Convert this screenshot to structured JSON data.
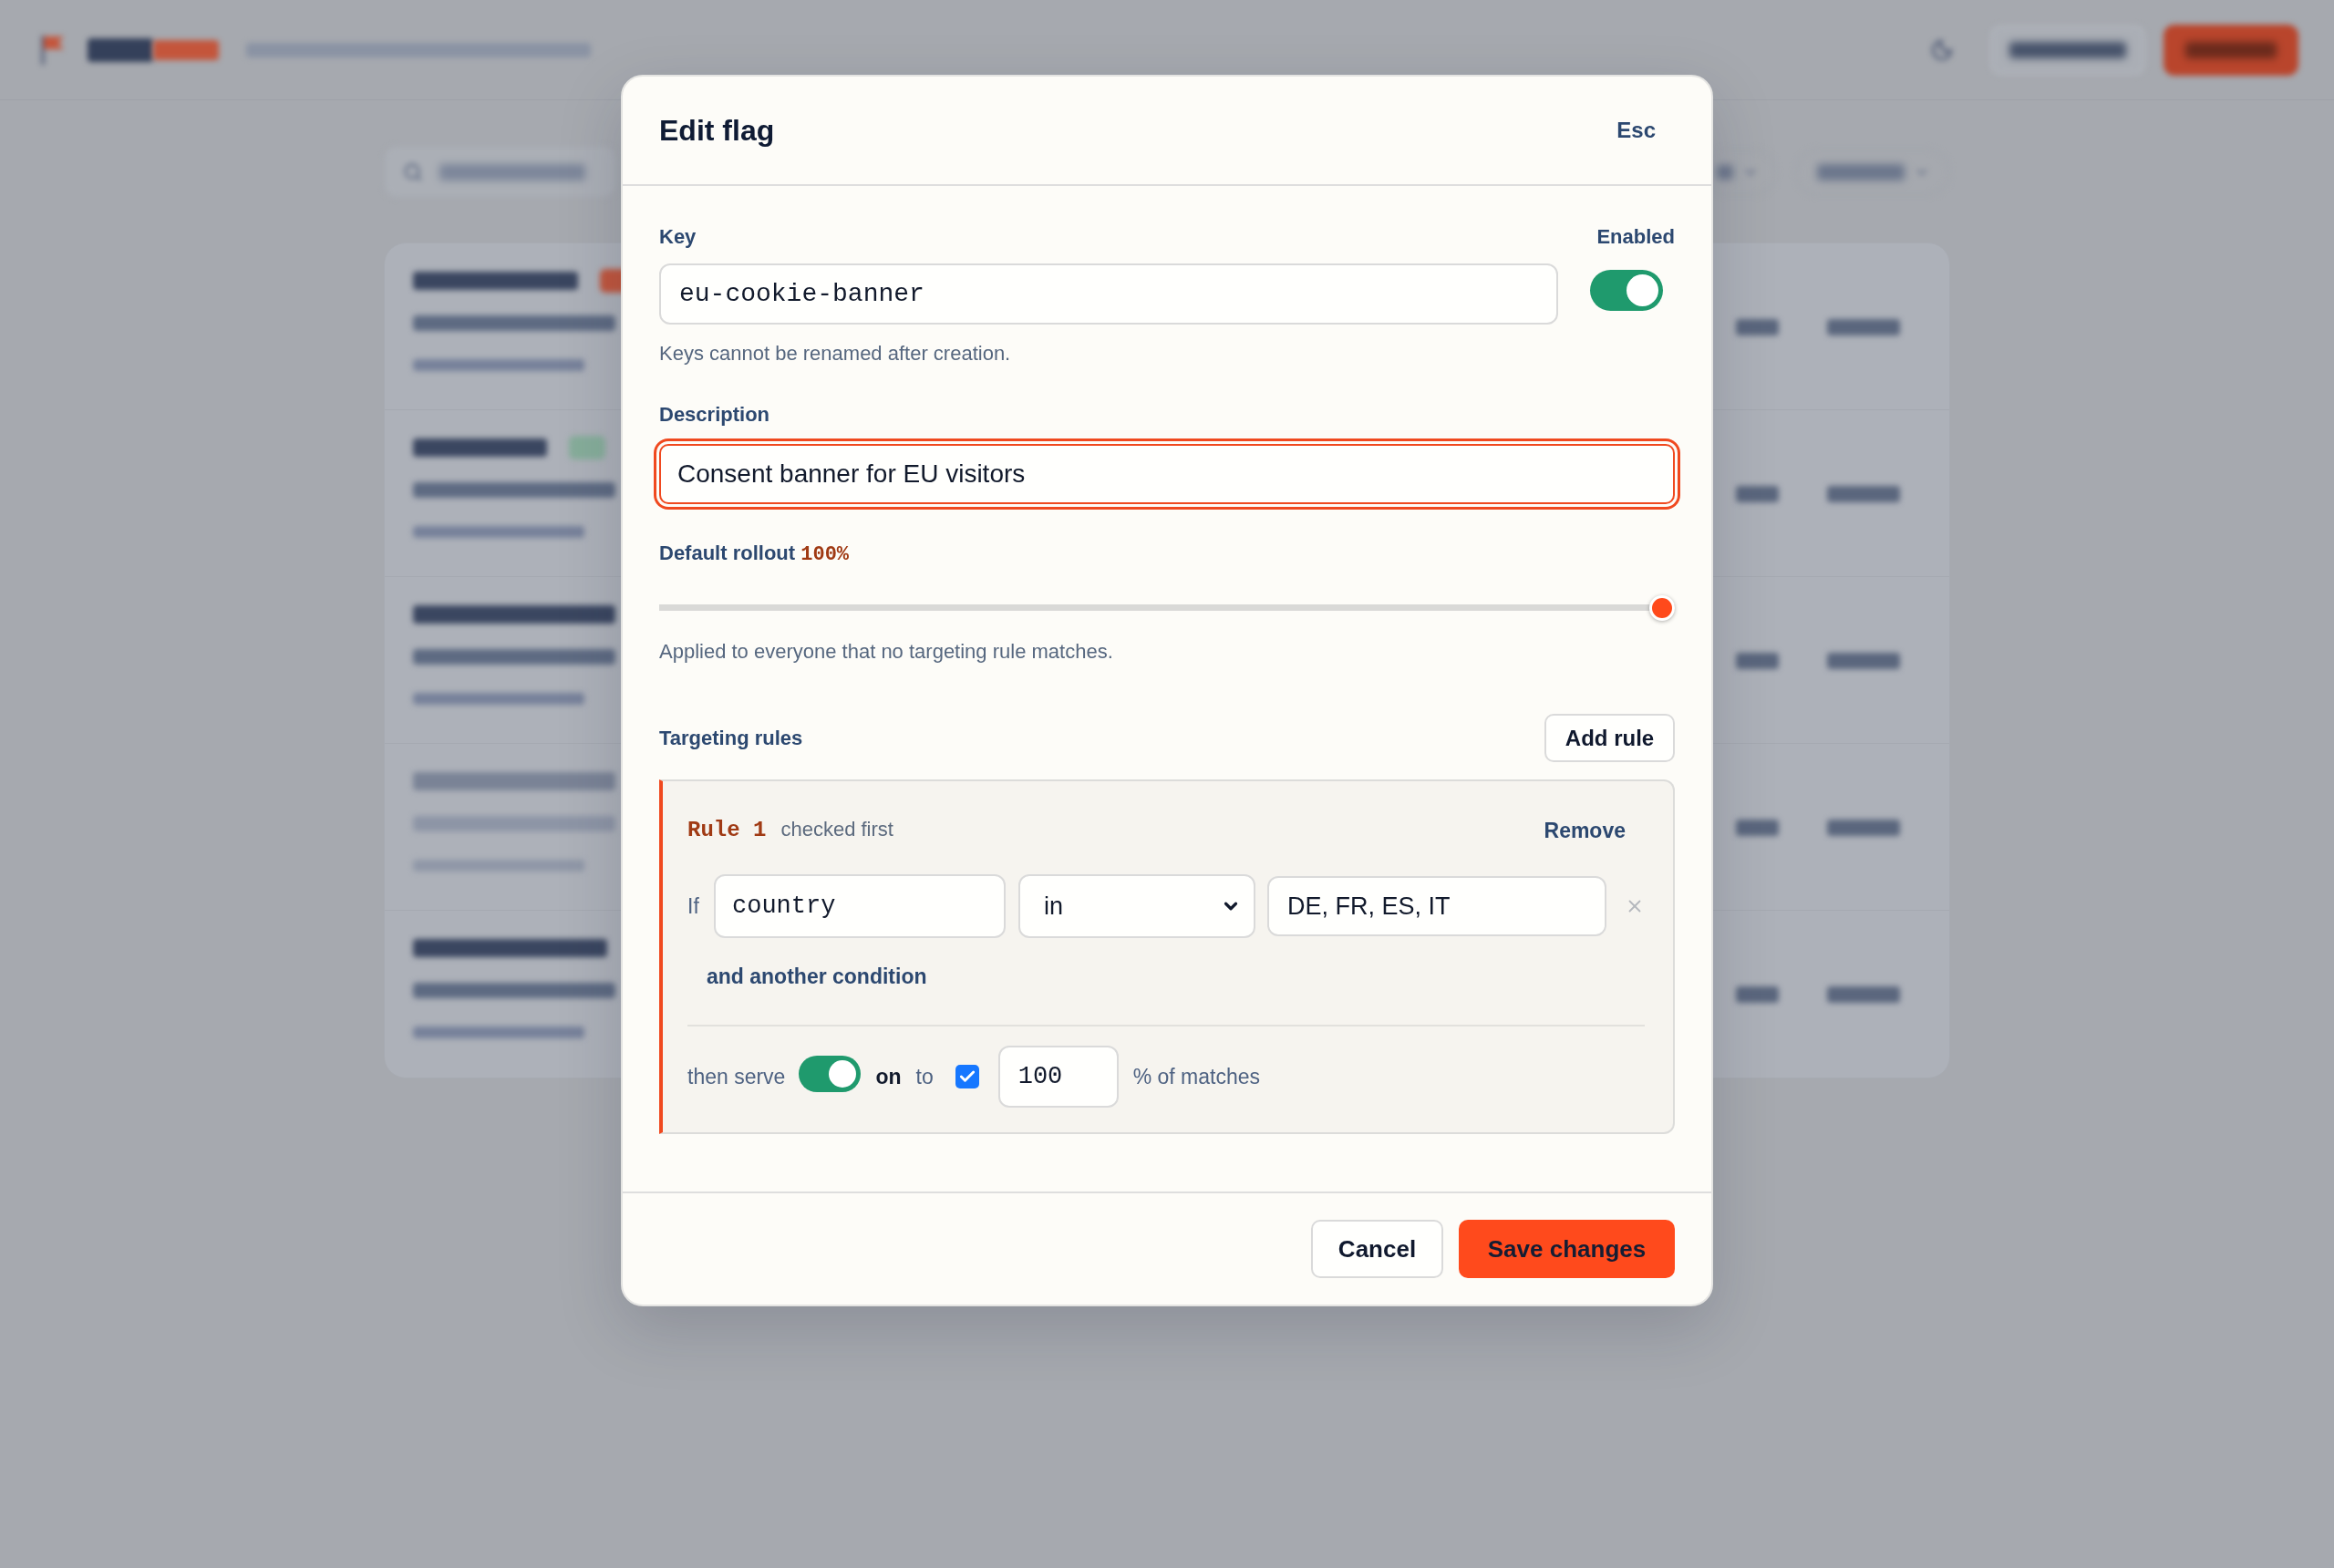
{
  "dialog": {
    "title": "Edit flag",
    "close_hint": "Esc",
    "key": {
      "label": "Key",
      "value": "eu-cookie-banner",
      "hint": "Keys cannot be renamed after creation."
    },
    "enabled": {
      "label": "Enabled",
      "on": true
    },
    "description": {
      "label": "Description",
      "value": "Consent banner for EU visitors",
      "focused": true
    },
    "rollout": {
      "label": "Default rollout",
      "reading": "100%",
      "level": 1,
      "hint": "Applied to everyone that no targeting rule matches."
    },
    "targeting": {
      "label": "Targeting rules",
      "add_button": "Add rule",
      "rules": [
        {
          "title": "Rule 1",
          "note": "checked first",
          "remove": "Remove",
          "conditions": [
            {
              "prefix": "If",
              "attribute": "country",
              "operator": "in",
              "values": "DE, FR, ES, IT"
            }
          ],
          "add_condition": "and another condition",
          "serve": {
            "label": "then serve",
            "on": true,
            "state_label": "on",
            "to": "to",
            "checkbox": {
              "checked": true
            },
            "percent": "100",
            "suffix": "% of matches"
          }
        }
      ]
    },
    "footer": {
      "buttons": [
        {
          "label": "Cancel",
          "kind": "secondary"
        },
        {
          "label": "Save changes",
          "kind": "primary"
        }
      ]
    }
  }
}
